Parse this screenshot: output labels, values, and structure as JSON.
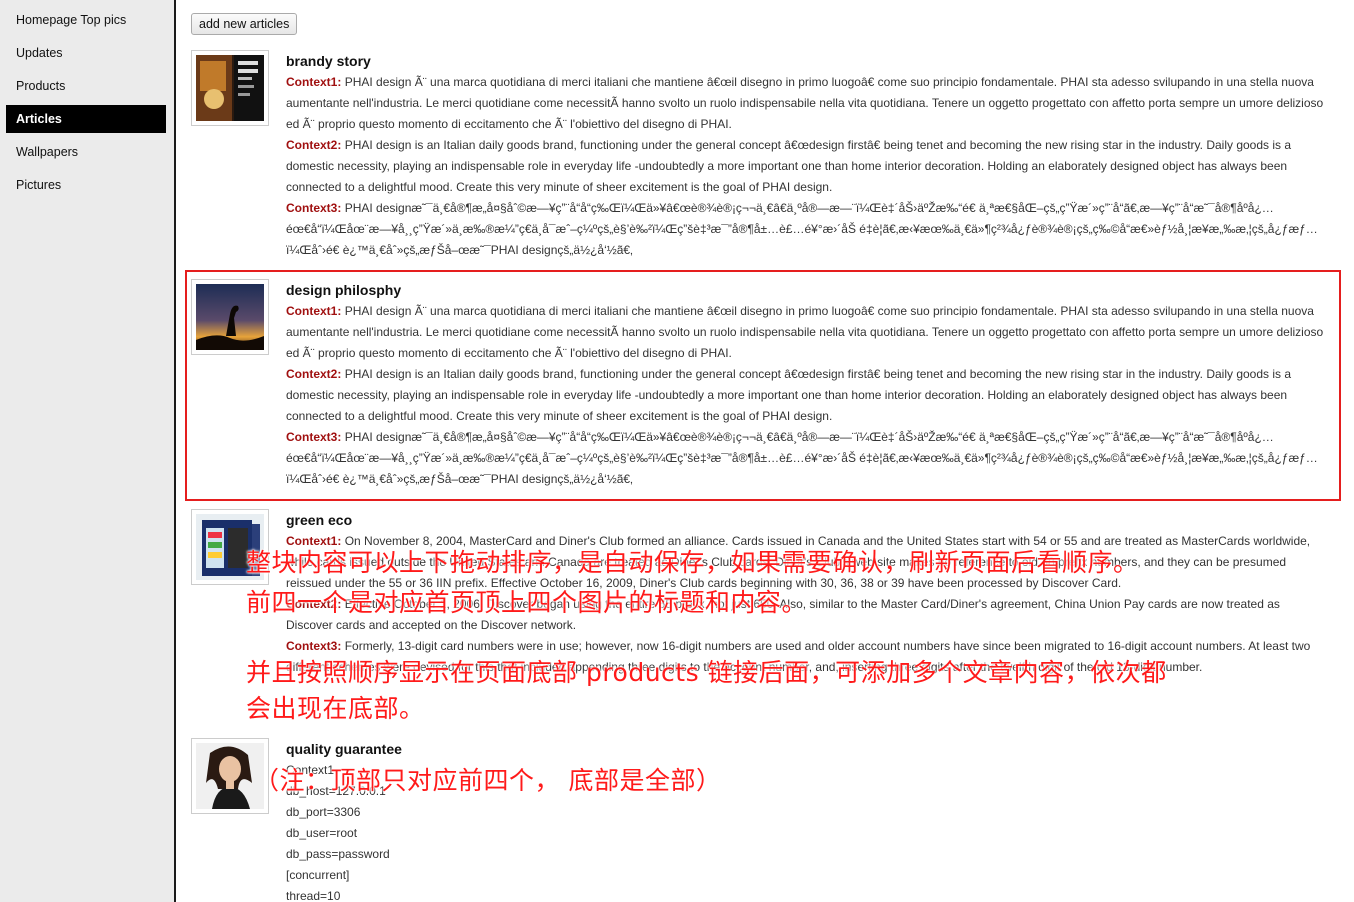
{
  "sidebar": {
    "items": [
      {
        "label": "Homepage Top pics",
        "active": false
      },
      {
        "label": "Updates",
        "active": false
      },
      {
        "label": "Products",
        "active": false
      },
      {
        "label": "Articles",
        "active": true
      },
      {
        "label": "Wallpapers",
        "active": false
      },
      {
        "label": "Pictures",
        "active": false
      }
    ]
  },
  "toolbar": {
    "add_label": "add new articles"
  },
  "articles": [
    {
      "title": "brandy story",
      "image": "brandy-story-thumbnail",
      "contexts": [
        {
          "label": "Context1:",
          "text": "PHAI design Ã¨ una marca quotidiana di merci italiani che mantiene â€œil disegno in primo luogoâ€ come suo principio fondamentale. PHAI sta adesso svilupando in una stella nuova aumentante nell'industria. Le merci quotidiane come necessitÃ  hanno svolto un ruolo indispensabile nella vita quotidiana. Tenere un oggetto progettato con affetto porta sempre un umore delizioso ed Ã¨ proprio questo momento di eccitamento che Ã¨ l'obiettivo del disegno di PHAI."
        },
        {
          "label": "Context2:",
          "text": "PHAI design is an Italian daily goods brand, functioning under the general concept â€œdesign firstâ€ being tenet and becoming the new rising star in the industry. Daily goods is a domestic necessity, playing an indispensable role in everyday life -undoubtedly a more important one than home interior decoration. Holding an elaborately designed object has always been connected to a delightful mood. Create this very minute of sheer excitement is the goal of PHAI design."
        },
        {
          "label": "Context3:",
          "text": "PHAI designæ˜¯ä¸€å®¶æ„å¤§åˆ©æ—¥ç”¨å“å“ç‰Œï¼Œä»¥â€œè®¾è®¡ç¬¬ä¸€â€ä¸ºå®—æ—¨ï¼Œè‡´åŠ›äºŽæ‰“é€ ä¸ªæ€§åŒ–çš„ç”Ÿæ´»ç”¨å“ã€‚æ—¥ç”¨å“æ˜¯å®¶åº­å¿…éœ€å“ï¼Œåœ¨æ—¥å¸¸ç”Ÿæ´»ä¸­æ‰®æ¼”ç€ä¸å¯æˆ–ç¼ºçš„è§’è‰²ï¼Œç”šè‡³æ¯”å®¶å±…è£…é¥°æ›´åŠ é‡è¦ã€‚æ‹¥æœ‰ä¸€ä»¶ç²¾å¿ƒè®¾è®¡çš„ç‰©å“æ€»èƒ½å¸¦æ¥æ„‰æ‚¦çš„å¿ƒæƒ…ï¼Œåˆ›é€ è¿™ä¸€åˆ»çš„æƒŠå–œæ˜¯PHAI designçš„ä½¿å‘½ã€‚"
        }
      ]
    },
    {
      "title": "design philosphy",
      "image": "design-philosophy-thumbnail",
      "contexts": [
        {
          "label": "Context1:",
          "text": "PHAI design Ã¨ una marca quotidiana di merci italiani che mantiene â€œil disegno in primo luogoâ€ come suo principio fondamentale. PHAI sta adesso svilupando in una stella nuova aumentante nell'industria. Le merci quotidiane come necessitÃ  hanno svolto un ruolo indispensabile nella vita quotidiana. Tenere un oggetto progettato con affetto porta sempre un umore delizioso ed Ã¨ proprio questo momento di eccitamento che Ã¨ l'obiettivo del disegno di PHAI."
        },
        {
          "label": "Context2:",
          "text": "PHAI design is an Italian daily goods brand, functioning under the general concept â€œdesign firstâ€ being tenet and becoming the new rising star in the industry. Daily goods is a domestic necessity, playing an indispensable role in everyday life -undoubtedly a more important one than home interior decoration. Holding an elaborately designed object has always been connected to a delightful mood. Create this very minute of sheer excitement is the goal of PHAI design."
        },
        {
          "label": "Context3:",
          "text": "PHAI designæ˜¯ä¸€å®¶æ„å¤§åˆ©æ—¥ç”¨å“å“ç‰Œï¼Œä»¥â€œè®¾è®¡ç¬¬ä¸€â€ä¸ºå®—æ—¨ï¼Œè‡´åŠ›äºŽæ‰“é€ ä¸ªæ€§åŒ–çš„ç”Ÿæ´»ç”¨å“ã€‚æ—¥ç”¨å“æ˜¯å®¶åº­å¿…éœ€å“ï¼Œåœ¨æ—¥å¸¸ç”Ÿæ´»ä¸­æ‰®æ¼”ç€ä¸å¯æˆ–ç¼ºçš„è§’è‰²ï¼Œç”šè‡³æ¯”å®¶å±…è£…é¥°æ›´åŠ é‡è¦ã€‚æ‹¥æœ‰ä¸€ä»¶ç²¾å¿ƒè®¾è®¡çš„ç‰©å“æ€»èƒ½å¸¦æ¥æ„‰æ‚¦çš„å¿ƒæƒ…ï¼Œåˆ›é€ è¿™ä¸€åˆ»çš„æƒŠå–œæ˜¯PHAI designçš„ä½¿å‘½ã€‚"
        }
      ]
    },
    {
      "title": "green eco",
      "image": "green-eco-thumbnail",
      "contexts": [
        {
          "label": "Context1:",
          "text": "On November 8, 2004, MasterCard and Diner's Club formed an alliance. Cards issued in Canada and the United States start with 54 or 55 and are treated as MasterCards worldwide, while cards issued outside the United States and Canada are treated as Diner's Club cards. Diner's Club's web site makes no reference to old 38 prefix numbers, and they can be presumed reissued under the 55 or 36 IIN prefix. Effective October 16, 2009, Diner's Club cards beginning with 30, 36, 38 or 39 have been processed by Discover Card."
        },
        {
          "label": "Context2:",
          "text": "Effective October 1, 2006, Discover began using the entire 65 prefix, not just 650. Also, similar to the Master Card/Diner's agreement, China Union Pay cards are now treated as Discover cards and accepted on the Discover network."
        },
        {
          "label": "Context3:",
          "text": "Formerly, 13-digit card numbers were in use; however, now 16-digit numbers are used and older account numbers have since been migrated to 16-digit account numbers. At least two different schemes were devised for this that included appending three digits to the account number, and, inserting three digits after the twelfth digit of the old 13-digit number."
        }
      ]
    },
    {
      "title": "quality guarantee",
      "image": "quality-guarantee-thumbnail",
      "context_label": "Context1",
      "lines": [
        "db_host=127.0.0.1",
        "db_port=3306",
        "db_user=root",
        "db_pass=password",
        "[concurrent]",
        "thread=10"
      ]
    }
  ],
  "annotations": {
    "line1": "整块内容可以上下拖动排序，是自动保存，如果需要确认，刷新页面后看顺序。",
    "line2": "前四一个是对应首页顶上四个图片的标题和内容。",
    "line3": "并且按照顺序显示在页面底部 products 链接后面，可添加多个文章内容，依次都",
    "line4": "会出现在底部。",
    "line5": "（注：顶部只对应前四个，  底部是全部）"
  }
}
